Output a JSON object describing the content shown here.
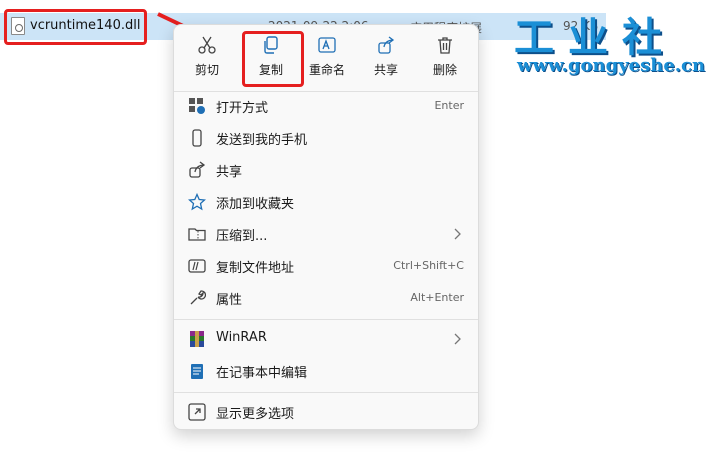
{
  "explorer": {
    "selected_file": {
      "name": "vcruntime140.dll",
      "date": "2021-09-22 2:06",
      "type": "应用程序扩展",
      "size": "92 KB"
    }
  },
  "watermark": {
    "title": "工业社",
    "url": "www.gongyeshe.cn"
  },
  "context_menu": {
    "quick_actions": [
      {
        "label": "剪切",
        "icon": "scissors-icon"
      },
      {
        "label": "复制",
        "icon": "copy-icon"
      },
      {
        "label": "重命名",
        "icon": "rename-icon"
      },
      {
        "label": "共享",
        "icon": "share-icon"
      },
      {
        "label": "删除",
        "icon": "trash-icon"
      }
    ],
    "items": [
      {
        "label": "打开方式",
        "shortcut": "Enter",
        "icon": "open-with-icon"
      },
      {
        "label": "发送到我的手机",
        "shortcut": "",
        "icon": "phone-icon"
      },
      {
        "label": "共享",
        "shortcut": "",
        "icon": "share-icon"
      },
      {
        "label": "添加到收藏夹",
        "shortcut": "",
        "icon": "star-icon"
      },
      {
        "label": "压缩到...",
        "shortcut": "",
        "icon": "zip-folder-icon",
        "submenu": true
      },
      {
        "label": "复制文件地址",
        "shortcut": "Ctrl+Shift+C",
        "icon": "path-icon"
      },
      {
        "label": "属性",
        "shortcut": "Alt+Enter",
        "icon": "wrench-icon"
      }
    ],
    "items2": [
      {
        "label": "WinRAR",
        "shortcut": "",
        "icon": "winrar-icon",
        "submenu": true
      },
      {
        "label": "在记事本中编辑",
        "shortcut": "",
        "icon": "notepad-icon"
      }
    ],
    "items3": [
      {
        "label": "显示更多选项",
        "shortcut": "",
        "icon": "more-options-icon"
      }
    ]
  },
  "colors": {
    "highlight_red": "#e51f1f",
    "selection_blue": "#cce4f7",
    "icon_blue": "#1f6fb5",
    "watermark_blue": "#1b8fd6"
  }
}
